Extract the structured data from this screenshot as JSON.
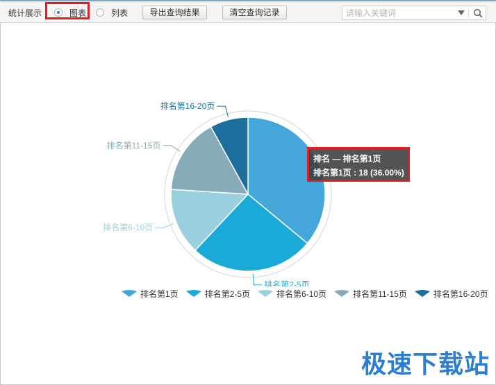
{
  "toolbar": {
    "label": "统计展示",
    "view_options": [
      {
        "label": "图表",
        "checked": true
      },
      {
        "label": "列表",
        "checked": false
      }
    ],
    "export_button": "导出查询结果",
    "clear_button": "清空查询记录",
    "search_placeholder": "请输入关键词"
  },
  "chart_data": {
    "type": "pie",
    "series_name": "排名",
    "slices": [
      {
        "label": "排名第1页",
        "value": 18,
        "percent": 36.0,
        "color": "#44a6d9"
      },
      {
        "label": "排名第2-5页",
        "value": 13,
        "percent": 26.0,
        "color": "#1aaad8"
      },
      {
        "label": "排名第6-10页",
        "value": 7,
        "percent": 14.0,
        "color": "#9ad0de"
      },
      {
        "label": "排名第11-15页",
        "value": 8,
        "percent": 16.0,
        "color": "#87acb9"
      },
      {
        "label": "排名第16-20页",
        "value": 4,
        "percent": 8.0,
        "color": "#1c6f9c"
      }
    ],
    "legend_position": "bottom-right"
  },
  "tooltip": {
    "title": "排名 — 排名第1页",
    "value_line": "排名第1页 : 18 (36.00%)"
  },
  "watermark": "极速下载站"
}
